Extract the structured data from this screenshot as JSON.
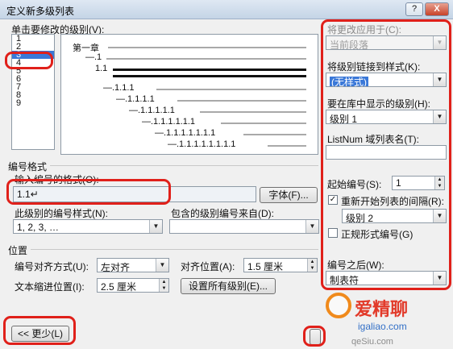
{
  "window": {
    "title": "定义新多级列表",
    "help_label": "?",
    "close_label": "X"
  },
  "levels": {
    "label": "单击要修改的级别(V):",
    "items": [
      "1",
      "2",
      "3",
      "4",
      "5",
      "6",
      "7",
      "8",
      "9"
    ],
    "selected": "3"
  },
  "preview": {
    "lines": [
      "第一章",
      "—.1",
      "1.1",
      "—.1.1.1",
      "—.1.1.1.1",
      "—.1.1.1.1.1",
      "—.1.1.1.1.1.1",
      "—.1.1.1.1.1.1.1",
      "—.1.1.1.1.1.1.1.1"
    ]
  },
  "number_format": {
    "section_label": "编号格式",
    "input_label": "输入编号的格式(O):",
    "value": "1.1↵",
    "font_button": "字体(F)...",
    "style_label": "此级别的编号样式(N):",
    "style_value": "1, 2, 3, …",
    "include_label": "包含的级别编号来自(D):",
    "include_value": ""
  },
  "position": {
    "section_label": "位置",
    "align_label": "编号对齐方式(U):",
    "align_value": "左对齐",
    "align_at_label": "对齐位置(A):",
    "align_at_value": "1.5 厘米",
    "indent_label": "文本缩进位置(I):",
    "indent_value": "2.5 厘米",
    "set_all_button": "设置所有级别(E)..."
  },
  "right_panel": {
    "apply_to_label": "将更改应用于(C):",
    "apply_to_value": "当前段落",
    "link_style_label": "将级别链接到样式(K):",
    "link_style_value": "(无样式)",
    "gallery_level_label": "要在库中显示的级别(H):",
    "gallery_level_value": "级别 1",
    "listnum_label": "ListNum 域列表名(T):",
    "listnum_value": "",
    "start_at_label": "起始编号(S):",
    "start_at_value": "1",
    "restart_label": "重新开始列表的间隔(R):",
    "restart_checked": true,
    "restart_value": "级别 2",
    "legal_label": "正规形式编号(G)",
    "legal_checked": false,
    "follow_label": "编号之后(W):",
    "follow_value": "制表符"
  },
  "footer": {
    "less_button": "<< 更少(L)"
  },
  "watermark": {
    "main": "爱精聊",
    "sub": "igaliao.com",
    "sub2": "qeSiu.com"
  },
  "colors": {
    "highlight_red": "#e0201a",
    "selection_blue": "#3a78d8",
    "watermark_orange": "#f08a1c"
  }
}
